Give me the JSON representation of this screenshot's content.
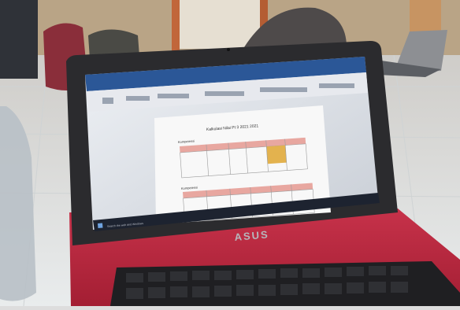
{
  "photo": {
    "laptop_brand": "ASUS",
    "document_title": "Kalkulasi Nilai Pt 3 2021 2021",
    "section_1_heading": "Kompetensi",
    "section_2_heading": "Kompetensi",
    "taskbar_search_placeholder": "Search the web and Windows",
    "colors": {
      "laptop_body": "#b8263a",
      "bezel": "#2b2b2e",
      "ribbon": "#2b5797",
      "table_header": "#e8a7a0",
      "highlight_cell": "#e3b24e",
      "floor": "#e2e5e6"
    }
  }
}
